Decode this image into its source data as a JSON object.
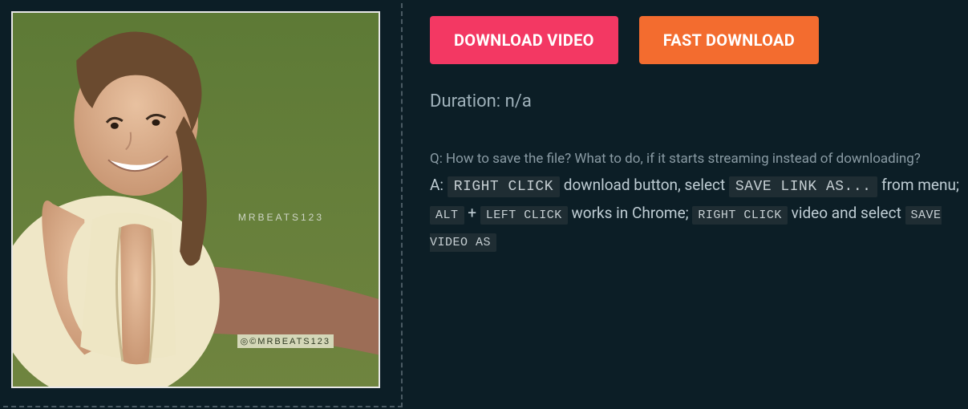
{
  "thumbnail": {
    "watermark_top": "MRBEATS123",
    "watermark_bottom": "◎©MRBEATS123"
  },
  "buttons": {
    "download": "DOWNLOAD VIDEO",
    "fast": "FAST DOWNLOAD"
  },
  "duration_label": "Duration: n/a",
  "help": {
    "question": "Q: How to save the file? What to do, if it starts streaming instead of downloading?",
    "answer_prefix": "A:",
    "kbd_right_click": "RIGHT CLICK",
    "txt_download_button": " download button, select ",
    "kbd_save_link_as": "SAVE LINK AS...",
    "txt_from_menu": " from menu;",
    "kbd_alt": "ALT",
    "txt_plus": " + ",
    "kbd_left_click": "LEFT CLICK",
    "txt_chrome": " works in Chrome; ",
    "kbd_right_click2": "RIGHT CLICK",
    "txt_video_select": " video and select ",
    "kbd_save_video_as": "SAVE VIDEO AS"
  }
}
